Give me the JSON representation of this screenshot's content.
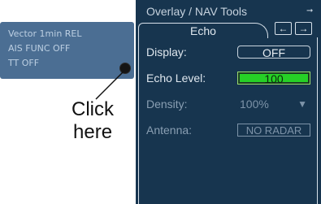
{
  "status_card": {
    "lines": [
      "Vector 1min REL",
      "AIS FUNC OFF",
      "TT OFF"
    ]
  },
  "callout": {
    "line1": "Click",
    "line2": "here"
  },
  "panel": {
    "title": "Overlay / NAV Tools",
    "header_arrow_glyph": "➞",
    "tab_label": "Echo",
    "nav_prev_glyph": "←",
    "nav_next_glyph": "→"
  },
  "settings": {
    "display": {
      "label": "Display:",
      "value": "OFF"
    },
    "echo_level": {
      "label": "Echo Level:",
      "value": "100",
      "fill_fraction": 1.0
    },
    "density": {
      "label": "Density:",
      "value": "100%",
      "arrow_glyph": "▼"
    },
    "antenna": {
      "label": "Antenna:",
      "value": "NO RADAR"
    }
  },
  "colors": {
    "panel_bg": "#17354f",
    "status_card_bg": "#4b6e93",
    "echo_level_green": "#26d126"
  },
  "icons": {
    "header_arrow": "right-arrow-icon",
    "nav_prev": "left-arrow-icon",
    "nav_next": "right-arrow-icon",
    "density_dropdown": "triangle-down-icon",
    "status_dot": "dot-icon"
  }
}
